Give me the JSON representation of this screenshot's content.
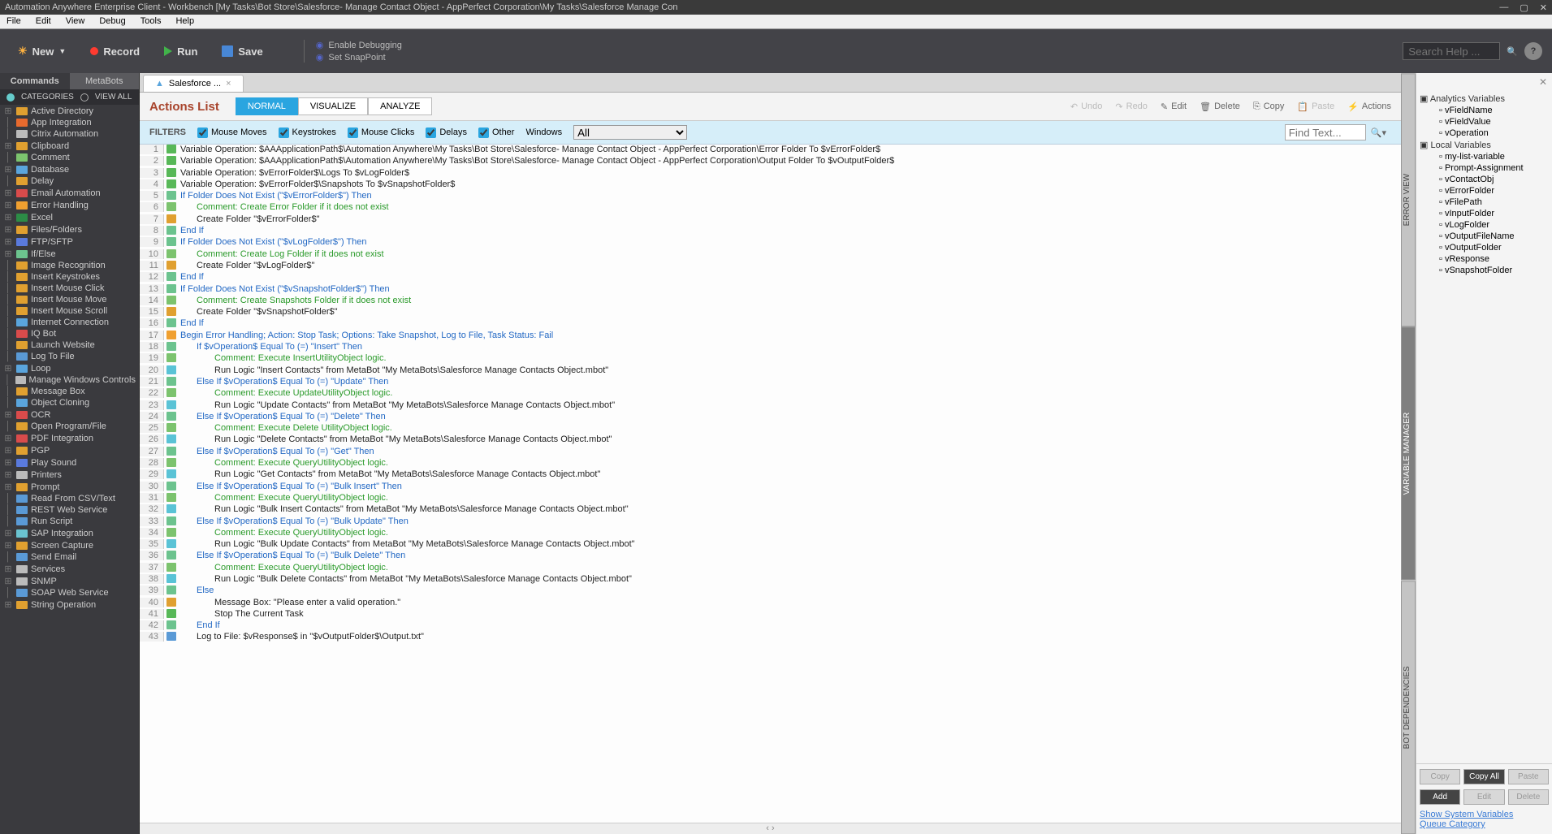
{
  "window": {
    "title": "Automation Anywhere Enterprise Client - Workbench [My Tasks\\Bot Store\\Salesforce- Manage Contact Object - AppPerfect Corporation\\My Tasks\\Salesforce Manage Con"
  },
  "menu": [
    "File",
    "Edit",
    "View",
    "Debug",
    "Tools",
    "Help"
  ],
  "toolbar": {
    "new": "New",
    "record": "Record",
    "run": "Run",
    "save": "Save",
    "enable_debug": "Enable Debugging",
    "snappoint": "Set SnapPoint",
    "search_ph": "Search Help ..."
  },
  "sidebar_tabs": {
    "commands": "Commands",
    "metabots": "MetaBots"
  },
  "sidebar_sub": {
    "categories": "CATEGORIES",
    "viewall": "VIEW ALL"
  },
  "commands": [
    {
      "t": "Active Directory",
      "c": "#e0a030",
      "p": "+"
    },
    {
      "t": "App Integration",
      "c": "#e86a2e",
      "p": ""
    },
    {
      "t": "Citrix Automation",
      "c": "#bbbbbb",
      "p": ""
    },
    {
      "t": "Clipboard",
      "c": "#e0a030",
      "p": "+"
    },
    {
      "t": "Comment",
      "c": "#7cc36e",
      "p": ""
    },
    {
      "t": "Database",
      "c": "#5aa5dd",
      "p": "+"
    },
    {
      "t": "Delay",
      "c": "#e0a030",
      "p": ""
    },
    {
      "t": "Email Automation",
      "c": "#d94b4b",
      "p": "+"
    },
    {
      "t": "Error Handling",
      "c": "#f0a030",
      "p": "+"
    },
    {
      "t": "Excel",
      "c": "#2c8c46",
      "p": "+"
    },
    {
      "t": "Files/Folders",
      "c": "#e0a030",
      "p": "+"
    },
    {
      "t": "FTP/SFTP",
      "c": "#5a7add",
      "p": "+"
    },
    {
      "t": "If/Else",
      "c": "#6cc38e",
      "p": "+"
    },
    {
      "t": "Image Recognition",
      "c": "#e0a030",
      "p": ""
    },
    {
      "t": "Insert Keystrokes",
      "c": "#e0a030",
      "p": ""
    },
    {
      "t": "Insert Mouse Click",
      "c": "#e0a030",
      "p": ""
    },
    {
      "t": "Insert Mouse Move",
      "c": "#e0a030",
      "p": ""
    },
    {
      "t": "Insert Mouse Scroll",
      "c": "#e0a030",
      "p": ""
    },
    {
      "t": "Internet Connection",
      "c": "#5aa5dd",
      "p": ""
    },
    {
      "t": "IQ Bot",
      "c": "#d94b4b",
      "p": ""
    },
    {
      "t": "Launch Website",
      "c": "#e0a030",
      "p": ""
    },
    {
      "t": "Log To File",
      "c": "#5a9ad6",
      "p": ""
    },
    {
      "t": "Loop",
      "c": "#5aa5dd",
      "p": "+"
    },
    {
      "t": "Manage Windows Controls",
      "c": "#bbbbbb",
      "p": ""
    },
    {
      "t": "Message Box",
      "c": "#e0a030",
      "p": ""
    },
    {
      "t": "Object Cloning",
      "c": "#5aa5dd",
      "p": ""
    },
    {
      "t": "OCR",
      "c": "#d94b4b",
      "p": "+"
    },
    {
      "t": "Open Program/File",
      "c": "#e0a030",
      "p": ""
    },
    {
      "t": "PDF Integration",
      "c": "#d94b4b",
      "p": "+"
    },
    {
      "t": "PGP",
      "c": "#e0a030",
      "p": "+"
    },
    {
      "t": "Play Sound",
      "c": "#5a7add",
      "p": "+"
    },
    {
      "t": "Printers",
      "c": "#bbbbbb",
      "p": "+"
    },
    {
      "t": "Prompt",
      "c": "#e0a030",
      "p": "+"
    },
    {
      "t": "Read From CSV/Text",
      "c": "#5a9ad6",
      "p": ""
    },
    {
      "t": "REST Web Service",
      "c": "#5a9ad6",
      "p": ""
    },
    {
      "t": "Run Script",
      "c": "#5a9ad6",
      "p": ""
    },
    {
      "t": "SAP Integration",
      "c": "#6ac3d0",
      "p": "+"
    },
    {
      "t": "Screen Capture",
      "c": "#e0a030",
      "p": "+"
    },
    {
      "t": "Send Email",
      "c": "#5a9ad6",
      "p": ""
    },
    {
      "t": "Services",
      "c": "#bbbbbb",
      "p": "+"
    },
    {
      "t": "SNMP",
      "c": "#bbbbbb",
      "p": "+"
    },
    {
      "t": "SOAP Web Service",
      "c": "#5a9ad6",
      "p": ""
    },
    {
      "t": "String Operation",
      "c": "#e0a030",
      "p": "+"
    }
  ],
  "doc_tab": "Salesforce ...",
  "actions_title": "Actions List",
  "modes": {
    "normal": "NORMAL",
    "visualize": "VISUALIZE",
    "analyze": "ANALYZE"
  },
  "al_buttons": {
    "undo": "Undo",
    "redo": "Redo",
    "edit": "Edit",
    "delete": "Delete",
    "copy": "Copy",
    "paste": "Paste",
    "actions": "Actions"
  },
  "filters": {
    "label": "FILTERS",
    "moves": "Mouse Moves",
    "keys": "Keystrokes",
    "clicks": "Mouse Clicks",
    "delays": "Delays",
    "other": "Other",
    "windows": "Windows",
    "winval": "All",
    "find_ph": "Find Text..."
  },
  "code": [
    {
      "n": 1,
      "c": "#58b858",
      "i": 0,
      "cls": "c-black",
      "t": "Variable Operation: $AAApplicationPath$\\Automation Anywhere\\My Tasks\\Bot Store\\Salesforce- Manage Contact Object - AppPerfect Corporation\\Error Folder To $vErrorFolder$"
    },
    {
      "n": 2,
      "c": "#58b858",
      "i": 0,
      "cls": "c-black",
      "t": "Variable Operation: $AAApplicationPath$\\Automation Anywhere\\My Tasks\\Bot Store\\Salesforce- Manage Contact Object - AppPerfect Corporation\\Output Folder To $vOutputFolder$"
    },
    {
      "n": 3,
      "c": "#58b858",
      "i": 0,
      "cls": "c-black",
      "t": "Variable Operation: $vErrorFolder$\\Logs To $vLogFolder$"
    },
    {
      "n": 4,
      "c": "#58b858",
      "i": 0,
      "cls": "c-black",
      "t": "Variable Operation: $vErrorFolder$\\Snapshots To $vSnapshotFolder$"
    },
    {
      "n": 5,
      "c": "#6cc38e",
      "i": 0,
      "cls": "c-blue",
      "t": "If Folder Does Not Exist (\"$vErrorFolder$\")  Then"
    },
    {
      "n": 6,
      "c": "#7cc36e",
      "i": 1,
      "cls": "c-green",
      "t": "Comment: Create Error Folder if it does not exist"
    },
    {
      "n": 7,
      "c": "#e0a030",
      "i": 1,
      "cls": "c-black",
      "t": "Create Folder \"$vErrorFolder$\""
    },
    {
      "n": 8,
      "c": "#6cc38e",
      "i": 0,
      "cls": "c-blue",
      "t": "End If"
    },
    {
      "n": 9,
      "c": "#6cc38e",
      "i": 0,
      "cls": "c-blue",
      "t": "If Folder Does Not Exist (\"$vLogFolder$\")  Then"
    },
    {
      "n": 10,
      "c": "#7cc36e",
      "i": 1,
      "cls": "c-green",
      "t": "Comment: Create Log Folder if it does not exist"
    },
    {
      "n": 11,
      "c": "#e0a030",
      "i": 1,
      "cls": "c-black",
      "t": "Create Folder \"$vLogFolder$\""
    },
    {
      "n": 12,
      "c": "#6cc38e",
      "i": 0,
      "cls": "c-blue",
      "t": "End If"
    },
    {
      "n": 13,
      "c": "#6cc38e",
      "i": 0,
      "cls": "c-blue",
      "t": "If Folder Does Not Exist (\"$vSnapshotFolder$\")  Then"
    },
    {
      "n": 14,
      "c": "#7cc36e",
      "i": 1,
      "cls": "c-green",
      "t": "Comment: Create Snapshots Folder if it does not exist"
    },
    {
      "n": 15,
      "c": "#e0a030",
      "i": 1,
      "cls": "c-black",
      "t": "Create Folder \"$vSnapshotFolder$\""
    },
    {
      "n": 16,
      "c": "#6cc38e",
      "i": 0,
      "cls": "c-blue",
      "t": "End If"
    },
    {
      "n": 17,
      "c": "#f0a030",
      "i": 0,
      "cls": "c-blue",
      "t": "Begin Error Handling; Action: Stop Task; Options: Take Snapshot, Log to File,  Task Status: Fail"
    },
    {
      "n": 18,
      "c": "#6cc38e",
      "i": 1,
      "cls": "c-blue",
      "t": "If $vOperation$ Equal To (=) \"Insert\" Then"
    },
    {
      "n": 19,
      "c": "#7cc36e",
      "i": 2,
      "cls": "c-green",
      "t": "Comment: Execute InsertUtilityObject logic."
    },
    {
      "n": 20,
      "c": "#5ac3d6",
      "i": 2,
      "cls": "c-black",
      "t": "Run Logic \"Insert Contacts\" from MetaBot \"My MetaBots\\Salesforce Manage Contacts Object.mbot\""
    },
    {
      "n": 21,
      "c": "#6cc38e",
      "i": 1,
      "cls": "c-blue",
      "t": "Else If $vOperation$ Equal To (=) \"Update\" Then"
    },
    {
      "n": 22,
      "c": "#7cc36e",
      "i": 2,
      "cls": "c-green",
      "t": "Comment: Execute UpdateUtilityObject logic."
    },
    {
      "n": 23,
      "c": "#5ac3d6",
      "i": 2,
      "cls": "c-black",
      "t": "Run Logic \"Update Contacts\" from MetaBot \"My MetaBots\\Salesforce Manage Contacts Object.mbot\""
    },
    {
      "n": 24,
      "c": "#6cc38e",
      "i": 1,
      "cls": "c-blue",
      "t": "Else If $vOperation$ Equal To (=) \"Delete\" Then"
    },
    {
      "n": 25,
      "c": "#7cc36e",
      "i": 2,
      "cls": "c-green",
      "t": "Comment: Execute Delete UtilityObject logic."
    },
    {
      "n": 26,
      "c": "#5ac3d6",
      "i": 2,
      "cls": "c-black",
      "t": "Run Logic \"Delete Contacts\" from MetaBot \"My MetaBots\\Salesforce Manage Contacts Object.mbot\""
    },
    {
      "n": 27,
      "c": "#6cc38e",
      "i": 1,
      "cls": "c-blue",
      "t": "Else If $vOperation$ Equal To (=) \"Get\" Then"
    },
    {
      "n": 28,
      "c": "#7cc36e",
      "i": 2,
      "cls": "c-green",
      "t": "Comment: Execute QueryUtilityObject logic."
    },
    {
      "n": 29,
      "c": "#5ac3d6",
      "i": 2,
      "cls": "c-black",
      "t": "Run Logic \"Get Contacts\" from MetaBot \"My MetaBots\\Salesforce Manage Contacts Object.mbot\""
    },
    {
      "n": 30,
      "c": "#6cc38e",
      "i": 1,
      "cls": "c-blue",
      "t": "Else If $vOperation$ Equal To (=) \"Bulk Insert\" Then"
    },
    {
      "n": 31,
      "c": "#7cc36e",
      "i": 2,
      "cls": "c-green",
      "t": "Comment: Execute QueryUtilityObject logic."
    },
    {
      "n": 32,
      "c": "#5ac3d6",
      "i": 2,
      "cls": "c-black",
      "t": "Run Logic \"Bulk Insert Contacts\" from MetaBot \"My MetaBots\\Salesforce Manage Contacts Object.mbot\""
    },
    {
      "n": 33,
      "c": "#6cc38e",
      "i": 1,
      "cls": "c-blue",
      "t": "Else If $vOperation$ Equal To (=) \"Bulk Update\" Then"
    },
    {
      "n": 34,
      "c": "#7cc36e",
      "i": 2,
      "cls": "c-green",
      "t": "Comment: Execute QueryUtilityObject logic."
    },
    {
      "n": 35,
      "c": "#5ac3d6",
      "i": 2,
      "cls": "c-black",
      "t": "Run Logic \"Bulk Update Contacts\" from MetaBot \"My MetaBots\\Salesforce Manage Contacts Object.mbot\""
    },
    {
      "n": 36,
      "c": "#6cc38e",
      "i": 1,
      "cls": "c-blue",
      "t": "Else If $vOperation$ Equal To (=) \"Bulk Delete\" Then"
    },
    {
      "n": 37,
      "c": "#7cc36e",
      "i": 2,
      "cls": "c-green",
      "t": "Comment: Execute QueryUtilityObject logic."
    },
    {
      "n": 38,
      "c": "#5ac3d6",
      "i": 2,
      "cls": "c-black",
      "t": "Run Logic \"Bulk Delete Contacts\" from MetaBot \"My MetaBots\\Salesforce Manage Contacts Object.mbot\""
    },
    {
      "n": 39,
      "c": "#6cc38e",
      "i": 1,
      "cls": "c-blue",
      "t": "Else"
    },
    {
      "n": 40,
      "c": "#e0a030",
      "i": 2,
      "cls": "c-black",
      "t": "Message Box: \"Please enter a valid operation.\""
    },
    {
      "n": 41,
      "c": "#58b858",
      "i": 2,
      "cls": "c-black",
      "t": "Stop The Current Task"
    },
    {
      "n": 42,
      "c": "#6cc38e",
      "i": 1,
      "cls": "c-blue",
      "t": "End If"
    },
    {
      "n": 43,
      "c": "#5a9ad6",
      "i": 1,
      "cls": "c-black",
      "t": "Log to File: $vResponse$ in \"$vOutputFolder$\\Output.txt\""
    }
  ],
  "vert_tabs": {
    "err": "ERROR VIEW",
    "var": "VARIABLE MANAGER",
    "bot": "BOT DEPENDENCIES"
  },
  "vars": {
    "analytics": "Analytics Variables",
    "a_items": [
      "vFieldName",
      "vFieldValue",
      "vOperation"
    ],
    "local": "Local Variables",
    "l_items": [
      "my-list-variable",
      "Prompt-Assignment",
      "vContactObj",
      "vErrorFolder",
      "vFilePath",
      "vInputFolder",
      "vLogFolder",
      "vOutputFileName",
      "vOutputFolder",
      "vResponse",
      "vSnapshotFolder"
    ]
  },
  "var_btns": {
    "copy": "Copy",
    "copyall": "Copy All",
    "paste": "Paste",
    "add": "Add",
    "edit": "Edit",
    "delete": "Delete"
  },
  "var_links": {
    "sys": "Show System Variables",
    "queue": "Queue Category"
  }
}
